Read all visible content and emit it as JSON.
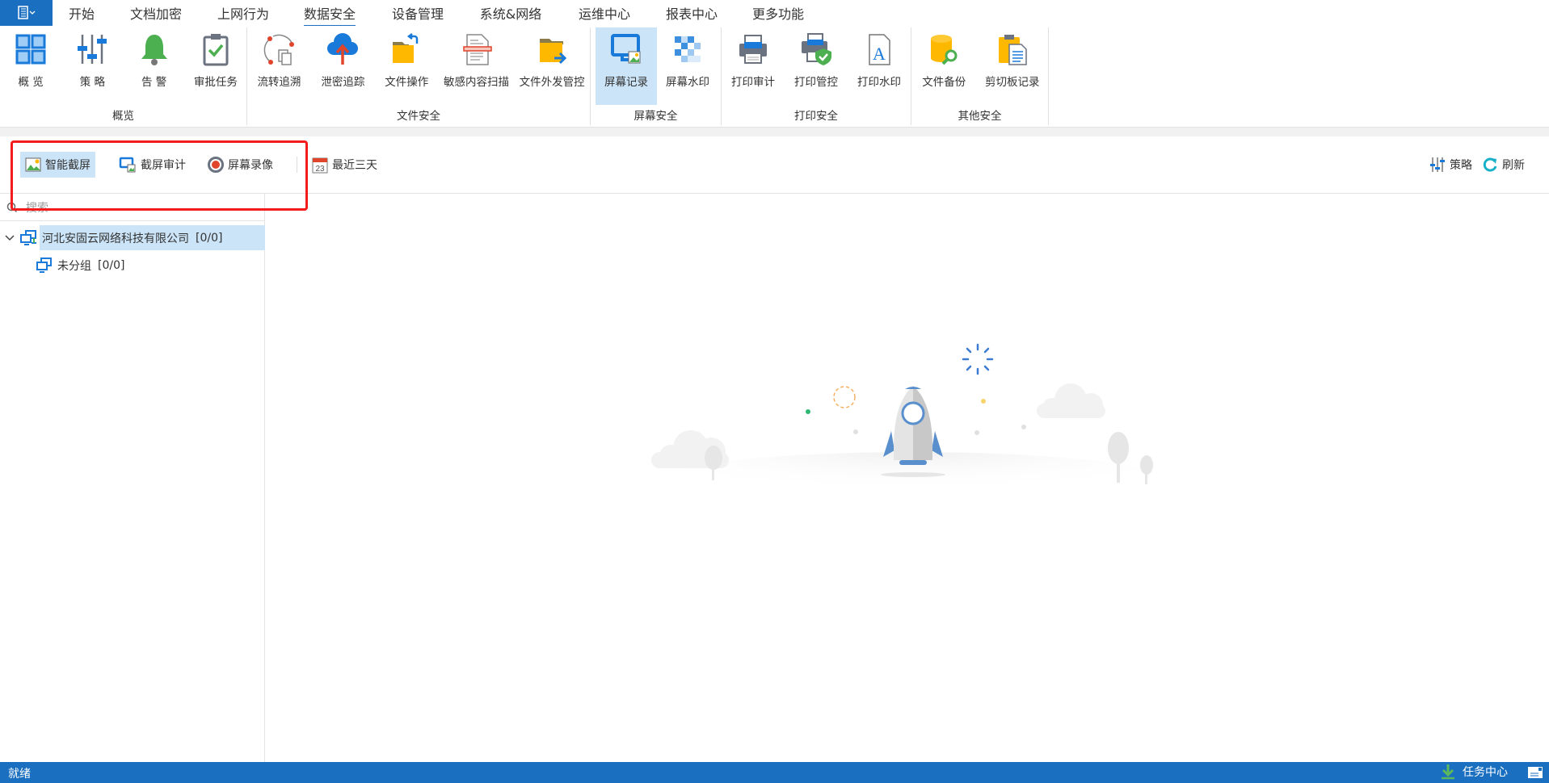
{
  "tabs": [
    {
      "label": "开始"
    },
    {
      "label": "文档加密"
    },
    {
      "label": "上网行为"
    },
    {
      "label": "数据安全",
      "active": true
    },
    {
      "label": "设备管理"
    },
    {
      "label": "系统&网络"
    },
    {
      "label": "运维中心"
    },
    {
      "label": "报表中心"
    },
    {
      "label": "更多功能"
    }
  ],
  "ribbon": {
    "groups": [
      {
        "label": "概览",
        "buttons": [
          {
            "label": "概 览",
            "icon": "grid-icon"
          },
          {
            "label": "策 略",
            "icon": "sliders-icon"
          },
          {
            "label": "告 警",
            "icon": "bell-icon"
          },
          {
            "label": "审批任务",
            "icon": "clipboard-check-icon"
          }
        ]
      },
      {
        "label": "文件安全",
        "buttons": [
          {
            "label": "流转追溯",
            "icon": "flow-trace-icon"
          },
          {
            "label": "泄密追踪",
            "icon": "cloud-upload-icon"
          },
          {
            "label": "文件操作",
            "icon": "folder-undo-icon"
          },
          {
            "label": "敏感内容扫描",
            "icon": "document-scan-icon"
          },
          {
            "label": "文件外发管控",
            "icon": "folder-send-icon"
          }
        ]
      },
      {
        "label": "屏幕安全",
        "buttons": [
          {
            "label": "屏幕记录",
            "icon": "monitor-image-icon",
            "active": true
          },
          {
            "label": "屏幕水印",
            "icon": "mosaic-icon"
          }
        ]
      },
      {
        "label": "打印安全",
        "buttons": [
          {
            "label": "打印审计",
            "icon": "printer-icon"
          },
          {
            "label": "打印管控",
            "icon": "printer-shield-icon"
          },
          {
            "label": "打印水印",
            "icon": "document-letter-icon"
          }
        ]
      },
      {
        "label": "其他安全",
        "buttons": [
          {
            "label": "文件备份",
            "icon": "database-search-icon"
          },
          {
            "label": "剪切板记录",
            "icon": "clipboard-doc-icon"
          }
        ]
      }
    ]
  },
  "toolbar": {
    "smart_capture": "智能截屏",
    "capture_audit": "截屏审计",
    "screen_record": "屏幕录像",
    "date_range": "最近三天",
    "calendar_day": "23",
    "policy": "策略",
    "refresh": "刷新"
  },
  "sidebar": {
    "search_placeholder": "搜索",
    "tree": [
      {
        "label": "河北安固云网络科技有限公司",
        "count": "[0/0]",
        "expanded": true,
        "selected": true
      },
      {
        "label": "未分组",
        "count": "[0/0]"
      }
    ]
  },
  "status": {
    "left": "就绪",
    "task_center": "任务中心"
  },
  "colors": {
    "accent": "#1a6fc0",
    "selected": "#cce4f7",
    "highlight_box": "#f21c1c"
  }
}
